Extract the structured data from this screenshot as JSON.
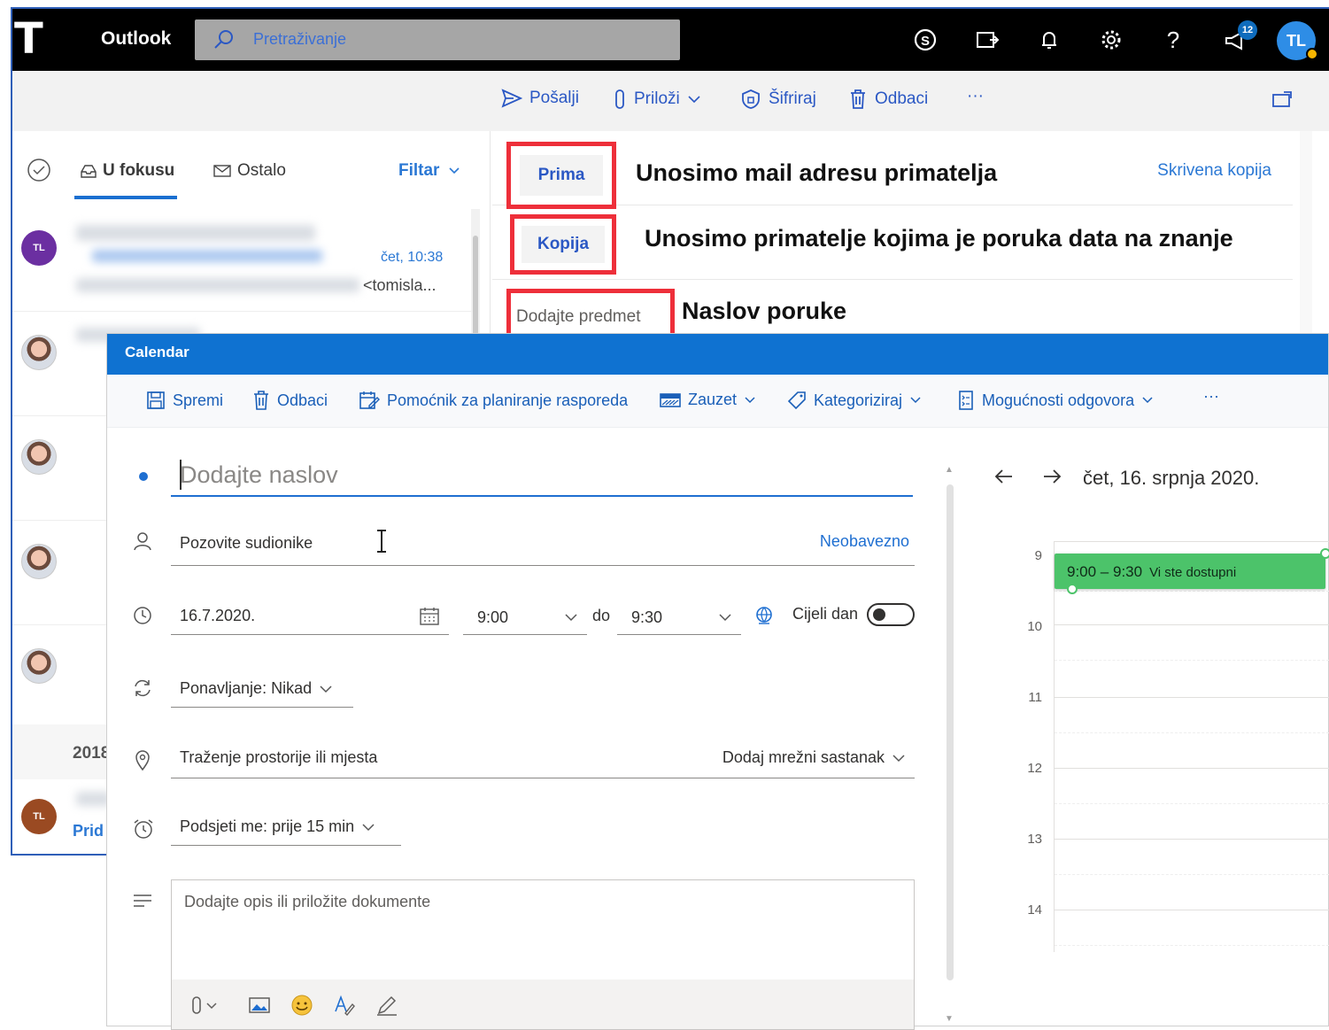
{
  "outlook": {
    "logo": "T",
    "app_name": "Outlook",
    "search_placeholder": "Pretraživanje",
    "notif_count": "12",
    "avatar": "TL",
    "commands": {
      "send": "Pošalji",
      "attach": "Priloži",
      "encrypt": "Šifriraj",
      "discard": "Odbaci",
      "more": "···"
    },
    "tabs": {
      "focused": "U fokusu",
      "other": "Ostalo",
      "filter": "Filtar"
    },
    "mails": [
      {
        "avatar": "TL",
        "time": "čet, 10:38",
        "preview": "<tomisla..."
      },
      {
        "avatar": ""
      },
      {
        "avatar": ""
      },
      {
        "avatar": ""
      },
      {
        "avatar": ""
      }
    ],
    "year_divider": "2018",
    "last_avatar": "TL",
    "last_preview": "Prid",
    "compose": {
      "to_label": "Prima",
      "to_note": "Unosimo mail adresu primatelja",
      "bcc": "Skrivena kopija",
      "cc_label": "Kopija",
      "cc_note": "Unosimo primatelje kojima je poruka data na znanje",
      "subject_placeholder": "Dodajte predmet",
      "subject_note": "Naslov poruke"
    },
    "colors": {
      "accent": "#0f72d1",
      "highlight": "#ee2f3a"
    }
  },
  "calendar": {
    "header_title": "Calendar",
    "toolbar": {
      "save": "Spremi",
      "discard": "Odbaci",
      "scheduling": "Pomoćnik za planiranje rasporeda",
      "busy": "Zauzet",
      "categorize": "Kategoriziraj",
      "response": "Mogućnosti odgovora",
      "more": "···"
    },
    "form": {
      "title_placeholder": "Dodajte naslov",
      "attendees_placeholder": "Pozovite sudionike",
      "optional": "Neobavezno",
      "date": "16.7.2020.",
      "start_time": "9:00",
      "to": "do",
      "end_time": "9:30",
      "all_day": "Cijeli dan",
      "repeat_label": "Ponavljanje:",
      "repeat_value": "Nikad",
      "location_placeholder": "Traženje prostorije ili mjesta",
      "online_meeting": "Dodaj mrežni sastanak",
      "reminder_label": "Podsjeti me:",
      "reminder_value": "prije 15 min",
      "description_placeholder": "Dodajte opis ili priložite dokumente"
    },
    "schedule": {
      "date": "čet, 16. srpnja 2020.",
      "hours": [
        "9",
        "10",
        "11",
        "12",
        "13",
        "14"
      ],
      "event_time": "9:00 – 9:30",
      "event_status": "Vi ste dostupni",
      "event_color": "#4cc36a"
    }
  }
}
